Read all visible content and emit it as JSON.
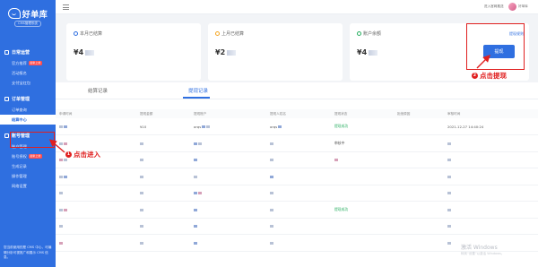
{
  "brand": {
    "title": "好单库",
    "subtitle": "CMS管理系统"
  },
  "sidebar": {
    "groups": [
      {
        "label": "日常运营",
        "items": [
          {
            "label": "官方推荐",
            "badge": "最新上线"
          },
          {
            "label": "活动报名"
          },
          {
            "label": "支付宝红包"
          }
        ]
      },
      {
        "label": "订单管理",
        "items": [
          {
            "label": "订单查询"
          },
          {
            "label": "结算中心",
            "active": true
          }
        ]
      },
      {
        "label": "账号管理",
        "items": [
          {
            "label": "账户管理"
          },
          {
            "label": "账号授权",
            "badge": "最新上线"
          },
          {
            "label": "生成记录"
          },
          {
            "label": "操作管理"
          },
          {
            "label": "网络设置"
          }
        ]
      }
    ],
    "footer": "您当前使用的是 CMS 中心，可编辑分析可视推广和展示 CMS 信息。"
  },
  "topbar": {
    "link": "进入官网推送",
    "user": "好单库"
  },
  "cards": {
    "month_settled": {
      "title": "本月已结算",
      "value": "¥4"
    },
    "last_month_settled": {
      "title": "上月已结算",
      "value": "¥2"
    },
    "balance": {
      "title": "账户余额",
      "value": "¥4"
    }
  },
  "withdraw": {
    "link": "提现规则",
    "button": "提现"
  },
  "tabs": [
    {
      "label": "结算记录"
    },
    {
      "label": "提现记录",
      "active": true
    }
  ],
  "table": {
    "headers": [
      "申请时间",
      "提现金额",
      "提现账户",
      "提现人姓名",
      "提现状态",
      "拒绝原因",
      "审核时间"
    ],
    "rows": [
      [
        "",
        "¥10",
        "orqs",
        "orqs",
        "提现成功",
        "",
        "2021-12-27 14:40:24"
      ],
      [
        "",
        "",
        "",
        "",
        "审核中",
        "",
        ""
      ],
      [
        "",
        "",
        "",
        "",
        "",
        "",
        ""
      ],
      [
        "",
        "",
        "",
        "",
        "",
        "",
        ""
      ],
      [
        "",
        "",
        "",
        "",
        "",
        "",
        ""
      ],
      [
        "",
        "",
        "",
        "",
        "提现成功",
        "",
        ""
      ],
      [
        "",
        "",
        "",
        "",
        "",
        "",
        ""
      ],
      [
        "",
        "",
        "",
        "",
        "",
        "",
        ""
      ]
    ]
  },
  "annotations": {
    "step1": {
      "num": "1",
      "text": "点击进入"
    },
    "step2": {
      "num": "2",
      "text": "点击提现"
    }
  },
  "watermark": {
    "title": "激活 Windows",
    "sub": "转到“设置”以激活 Windows。"
  },
  "colors": {
    "primary": "#2f6fe0",
    "annotation": "#e02020",
    "success": "#27ae60"
  }
}
